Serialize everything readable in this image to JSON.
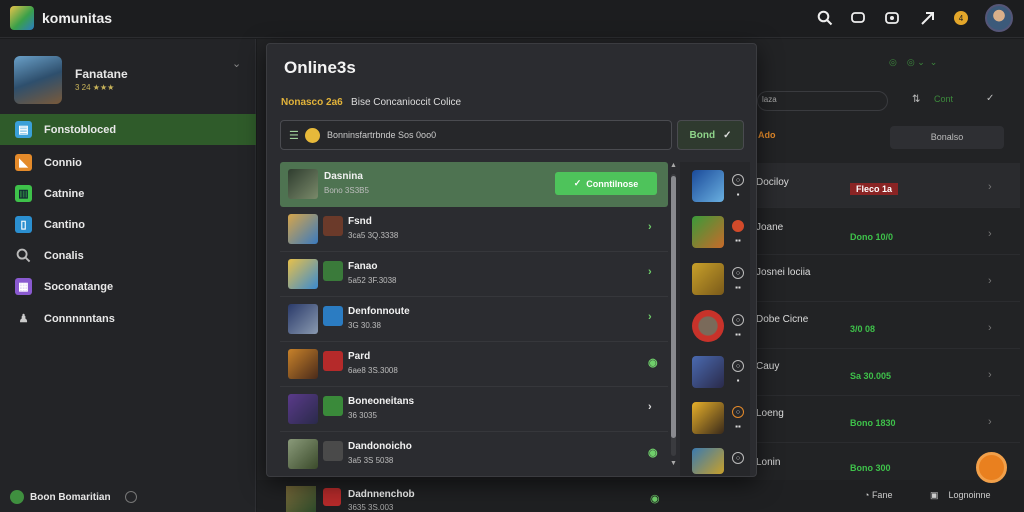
{
  "app": {
    "title": "komunitas"
  },
  "sidebar": {
    "profile_name": "Fanatane",
    "profile_sub": "3 24 ★★★",
    "items": [
      {
        "label": "Fonstobloced",
        "icon": "home-icon",
        "color": "#3aa0d8"
      },
      {
        "label": "Connio",
        "icon": "game-icon",
        "color": "#e48a2a"
      },
      {
        "label": "Catnine",
        "icon": "chart-icon",
        "color": "#3ec14a"
      },
      {
        "label": "Cantino",
        "icon": "book-icon",
        "color": "#2b8fd0"
      },
      {
        "label": "Conalis",
        "icon": "search-icon",
        "color": "#a8a8a8"
      },
      {
        "label": "Soconatange",
        "icon": "grid-icon",
        "color": "#8a5ad0"
      },
      {
        "label": "Connnnntans",
        "icon": "people-icon",
        "color": "#c8c8c8"
      }
    ],
    "footer": "Boon Bomaritian"
  },
  "modal": {
    "title": "Online3s",
    "subtitle_highlight": "Nonasco 2a6",
    "subtitle_rest": "Bise Concanioccit Colice",
    "search_text": "Bonninsfartrbnde  Sos 0oo0",
    "filter_label": "Bond",
    "rows": [
      {
        "name": "Dasnina",
        "date": "Bono 3S3B5",
        "action": "Conntilnose"
      },
      {
        "name": "Fsnd",
        "date": "3ca5 3Q.3338"
      },
      {
        "name": "Fanao",
        "date": "5a52 3F.3038"
      },
      {
        "name": "Denfonnoute",
        "date": "3G 30.38"
      },
      {
        "name": "Pard",
        "date": "6ae8 3S.3008"
      },
      {
        "name": "Boneoneitans",
        "date": "36 3035"
      },
      {
        "name": "Dandonoicho",
        "date": "3a5 3S 5038"
      },
      {
        "name": "Dadnnenchob",
        "date": "3635 3S.003"
      }
    ]
  },
  "background": {
    "search_text": "laza",
    "top_right": "Cont",
    "button": "Bonalso",
    "orange_label": "Ado",
    "list": [
      {
        "label": "Dociloy",
        "tag": "Fleco 1a"
      },
      {
        "label": "Joane",
        "tag": "Dono 10/0"
      },
      {
        "label": "Josnei lociia",
        "tag": ""
      },
      {
        "label": "Dobe Cicne",
        "tag": "3/0 08"
      },
      {
        "label": "Cauy",
        "tag": "Sa 30.005"
      },
      {
        "label": "Loeng",
        "tag": "Bono 1830"
      },
      {
        "label": "Lonin",
        "tag": "Bono 300"
      }
    ],
    "footer_left": "Fane",
    "footer_right": "Lognoinne"
  }
}
